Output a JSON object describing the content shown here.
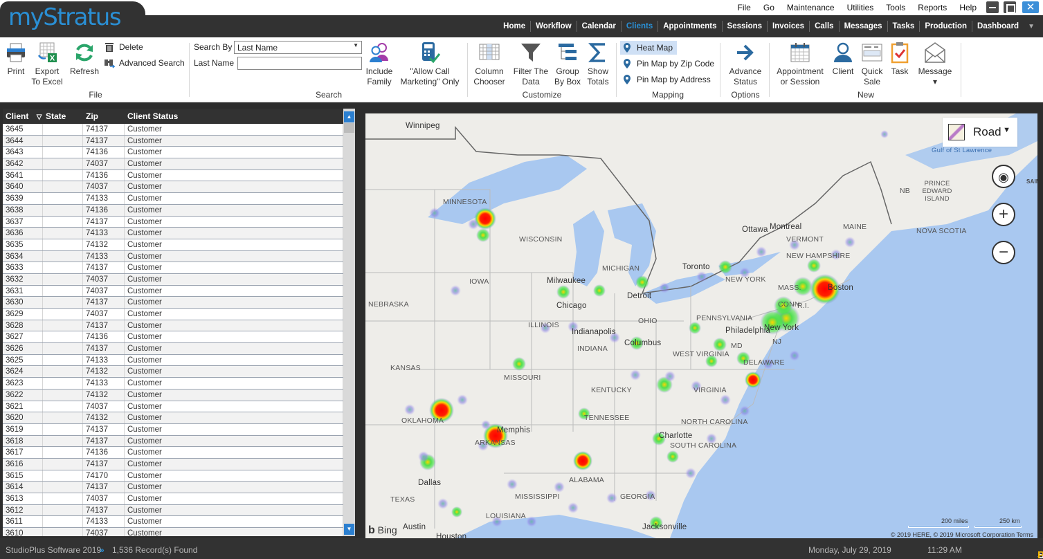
{
  "app": {
    "logo": "myStratus",
    "top_menu": [
      "File",
      "Go",
      "Maintenance",
      "Utilities",
      "Tools",
      "Reports",
      "Help"
    ],
    "window_controls": {
      "minimize": "minimize",
      "restore": "restore",
      "close": "✕"
    }
  },
  "nav": {
    "items": [
      "Home",
      "Workflow",
      "Calendar",
      "Clients",
      "Appointments",
      "Sessions",
      "Invoices",
      "Calls",
      "Messages",
      "Tasks",
      "Production",
      "Dashboard"
    ],
    "active": "Clients",
    "more_caret": "▼"
  },
  "ribbon": {
    "file": {
      "print": "Print",
      "export": [
        "Export",
        "To Excel"
      ],
      "refresh": "Refresh",
      "delete": "Delete",
      "advanced_search": "Advanced Search",
      "group_label": "File"
    },
    "search": {
      "search_by_label": "Search By",
      "search_by_value": "Last Name",
      "last_name_label": "Last Name",
      "last_name_value": "",
      "group_label": "Search"
    },
    "include_family": [
      "Include",
      "Family"
    ],
    "allow_call": [
      "\"Allow Call",
      "Marketing\" Only"
    ],
    "customize": {
      "column_chooser": [
        "Column",
        "Chooser"
      ],
      "filter": [
        "Filter The",
        "Data"
      ],
      "group_by_box": [
        "Group",
        "By Box"
      ],
      "show_totals": [
        "Show",
        "Totals"
      ],
      "group_label": "Customize"
    },
    "mapping": {
      "heat_map": "Heat Map",
      "pin_zip": "Pin Map by Zip Code",
      "pin_address": "Pin Map by Address",
      "group_label": "Mapping"
    },
    "options": {
      "advance_status": [
        "Advance",
        "Status"
      ],
      "group_label": "Options"
    },
    "new": {
      "appointment": [
        "Appointment",
        "or Session"
      ],
      "client": "Client",
      "quick_sale": [
        "Quick",
        "Sale"
      ],
      "task": "Task",
      "message": "Message",
      "message_caret": "▾",
      "group_label": "New"
    }
  },
  "grid": {
    "columns": [
      "Client",
      "State",
      "Zip",
      "Client Status"
    ],
    "sort_icon": "▽",
    "rows": [
      [
        "3645",
        "",
        "74137",
        "Customer"
      ],
      [
        "3644",
        "",
        "74137",
        "Customer"
      ],
      [
        "3643",
        "",
        "74136",
        "Customer"
      ],
      [
        "3642",
        "",
        "74037",
        "Customer"
      ],
      [
        "3641",
        "",
        "74136",
        "Customer"
      ],
      [
        "3640",
        "",
        "74037",
        "Customer"
      ],
      [
        "3639",
        "",
        "74133",
        "Customer"
      ],
      [
        "3638",
        "",
        "74136",
        "Customer"
      ],
      [
        "3637",
        "",
        "74137",
        "Customer"
      ],
      [
        "3636",
        "",
        "74133",
        "Customer"
      ],
      [
        "3635",
        "",
        "74132",
        "Customer"
      ],
      [
        "3634",
        "",
        "74133",
        "Customer"
      ],
      [
        "3633",
        "",
        "74137",
        "Customer"
      ],
      [
        "3632",
        "",
        "74037",
        "Customer"
      ],
      [
        "3631",
        "",
        "74037",
        "Customer"
      ],
      [
        "3630",
        "",
        "74137",
        "Customer"
      ],
      [
        "3629",
        "",
        "74037",
        "Customer"
      ],
      [
        "3628",
        "",
        "74137",
        "Customer"
      ],
      [
        "3627",
        "",
        "74136",
        "Customer"
      ],
      [
        "3626",
        "",
        "74137",
        "Customer"
      ],
      [
        "3625",
        "",
        "74133",
        "Customer"
      ],
      [
        "3624",
        "",
        "74132",
        "Customer"
      ],
      [
        "3623",
        "",
        "74133",
        "Customer"
      ],
      [
        "3622",
        "",
        "74132",
        "Customer"
      ],
      [
        "3621",
        "",
        "74037",
        "Customer"
      ],
      [
        "3620",
        "",
        "74132",
        "Customer"
      ],
      [
        "3619",
        "",
        "74137",
        "Customer"
      ],
      [
        "3618",
        "",
        "74137",
        "Customer"
      ],
      [
        "3617",
        "",
        "74136",
        "Customer"
      ],
      [
        "3616",
        "",
        "74137",
        "Customer"
      ],
      [
        "3615",
        "",
        "74170",
        "Customer"
      ],
      [
        "3614",
        "",
        "74137",
        "Customer"
      ],
      [
        "3613",
        "",
        "74037",
        "Customer"
      ],
      [
        "3612",
        "",
        "74137",
        "Customer"
      ],
      [
        "3611",
        "",
        "74133",
        "Customer"
      ],
      [
        "3610",
        "",
        "74037",
        "Customer"
      ]
    ]
  },
  "map": {
    "style_selector": "Road",
    "style_caret": "▼",
    "controls": {
      "locate": "◉",
      "zoom_in": "+",
      "zoom_out": "−"
    },
    "states": [
      "MINNESOTA",
      "WISCONSIN",
      "IOWA",
      "NEBRASKA",
      "ILLINOIS",
      "INDIANA",
      "OHIO",
      "MICHIGAN",
      "KANSAS",
      "MISSOURI",
      "KENTUCKY",
      "OKLAHOMA",
      "ARKANSAS",
      "TENNESSEE",
      "NORTH CAROLINA",
      "SOUTH CAROLINA",
      "ALABAMA",
      "GEORGIA",
      "MISSISSIPPI",
      "LOUISIANA",
      "TEXAS",
      "PENNSYLVANIA",
      "NEW YORK",
      "WEST VIRGINIA",
      "VIRGINIA",
      "MD",
      "DELAWARE",
      "NJ",
      "CONN",
      "R.I.",
      "MASS.",
      "VERMONT",
      "NEW HAMPSHIRE",
      "MAINE",
      "NB",
      "PRINCE EDWARD ISLAND",
      "NOVA SCOTIA"
    ],
    "cities": [
      "Winnipeg",
      "Milwaukee",
      "Chicago",
      "Detroit",
      "Toronto",
      "Ottawa",
      "Montreal",
      "Boston",
      "New York",
      "Philadelphia",
      "Indianapolis",
      "Columbus",
      "Memphis",
      "Charlotte",
      "Dallas",
      "Austin",
      "Houston",
      "Jacksonville"
    ],
    "water": [
      "Gulf of St Lawrence"
    ],
    "edge_label": "SAIN",
    "scale": {
      "miles": "200 miles",
      "km": "250 km"
    },
    "bing": "Bing",
    "copyright": "© 2019 HERE, © 2019 Microsoft Corporation  Terms"
  },
  "status": {
    "company": "StudioPlus Software 2019",
    "arrow": "»",
    "records": "1,536 Record(s) Found",
    "date": "Monday, July 29, 2019",
    "time": "11:29 AM",
    "brand_a": "Studio",
    "brand_b": "Plus"
  },
  "colors": {
    "accent": "#2a8fd4",
    "dark_bar": "#323232",
    "heat_hot": "#ff0000",
    "heat_mid": "#ffd400",
    "heat_low": "#50e050",
    "heat_faint": "#8a7fe6",
    "water": "#a9c8f0"
  }
}
